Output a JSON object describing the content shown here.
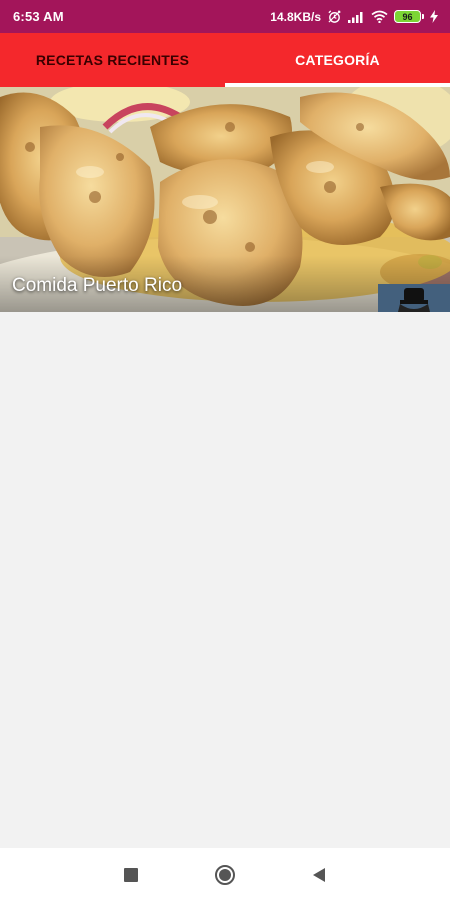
{
  "status_bar": {
    "time": "6:53 AM",
    "net_speed": "14.8KB/s",
    "battery_level": "96",
    "icons": [
      "alarm-icon",
      "signal-icon",
      "wifi-icon",
      "battery-icon",
      "charging-icon"
    ]
  },
  "tabs": [
    {
      "label": "RECETAS RECIENTES",
      "active": false
    },
    {
      "label": "CATEGORÍA",
      "active": true
    }
  ],
  "categories": [
    {
      "title": "Comida Puerto Rico",
      "image": "grilled-shrimp-photo"
    }
  ],
  "nav_bar": {
    "buttons": [
      "recents-button",
      "home-button",
      "back-button"
    ]
  },
  "colors": {
    "status_bar": "#a3155a",
    "tab_bar": "#f4282c",
    "tab_active_text": "#ffffff",
    "tab_inactive_text": "#3a0000",
    "background": "#f2f2f2"
  }
}
